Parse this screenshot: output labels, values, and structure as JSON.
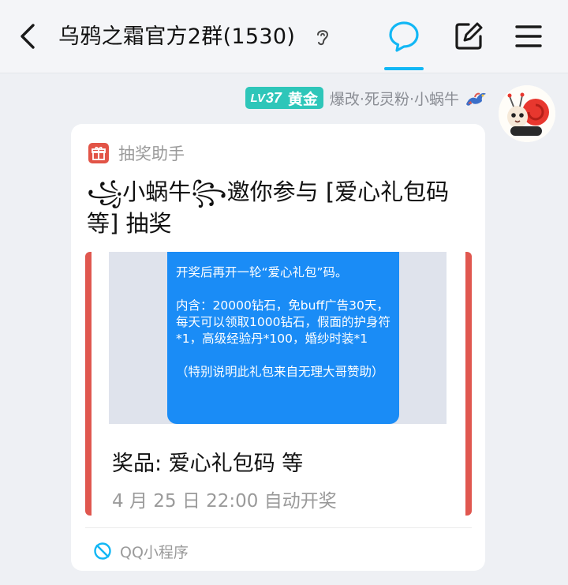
{
  "header": {
    "title": "乌鸦之霜官方2群(1530)",
    "back_icon": "chevron-left-icon",
    "ear_icon": "ear-icon",
    "chat_icon": "chat-bubble-icon",
    "edit_icon": "edit-icon",
    "menu_icon": "menu-icon",
    "accent_color": "#12b7f5"
  },
  "sender": {
    "level_prefix": "LV",
    "level_number": "37",
    "rank": "黄金",
    "name": "爆改·死灵粉·小蜗牛",
    "badge_color": "#2ec6b9",
    "avatar_icon": "snail-avatar-icon",
    "decoration_icon": "dragon-icon"
  },
  "card": {
    "source_label": "抽奖助手",
    "source_icon": "gift-icon",
    "title": "꧁小蜗牛꧂邀你参与 [爱心礼包码等] 抽奖",
    "image_text": {
      "line1": "开奖后再开一轮“爱心礼包”码。",
      "line2": "内含：20000钻石，免buff广告30天，每天可以领取1000钻石，假面的护身符*1，高级经验丹*100，婚纱时装*1",
      "line3": "（特别说明此礼包来自无理大哥赞助）"
    },
    "prize": "奖品: 爱心礼包码 等",
    "draw_time": "4 月 25 日 22:00 自动开奖",
    "footer_label": "QQ小程序",
    "footer_icon": "qq-miniprogram-icon",
    "border_color": "#e0574f"
  }
}
